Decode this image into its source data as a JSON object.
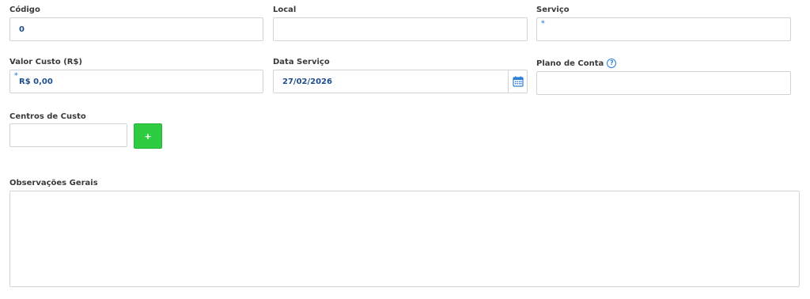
{
  "form": {
    "codigo": {
      "label": "Código",
      "value": "0"
    },
    "local": {
      "label": "Local",
      "value": ""
    },
    "servico": {
      "label": "Serviço",
      "value": "",
      "required_mark": "*"
    },
    "valor_custo": {
      "label": "Valor Custo (R$)",
      "value": "R$ 0,00",
      "required_mark": "*"
    },
    "data_servico": {
      "label": "Data Serviço",
      "value": "27/02/2026",
      "icon": "calendar-icon"
    },
    "plano_conta": {
      "label": "Plano de Conta",
      "value": "",
      "help_icon": "?"
    },
    "centros_custo": {
      "label": "Centros de Custo",
      "value": "",
      "add_label": "+"
    },
    "observacoes": {
      "label": "Observações Gerais",
      "value": ""
    }
  },
  "colors": {
    "accent_value": "#1f4e8c",
    "add_button": "#2ecc40",
    "help_icon": "#2a7fd4",
    "required_mark": "#4a90d9",
    "border": "#cfd4da"
  }
}
